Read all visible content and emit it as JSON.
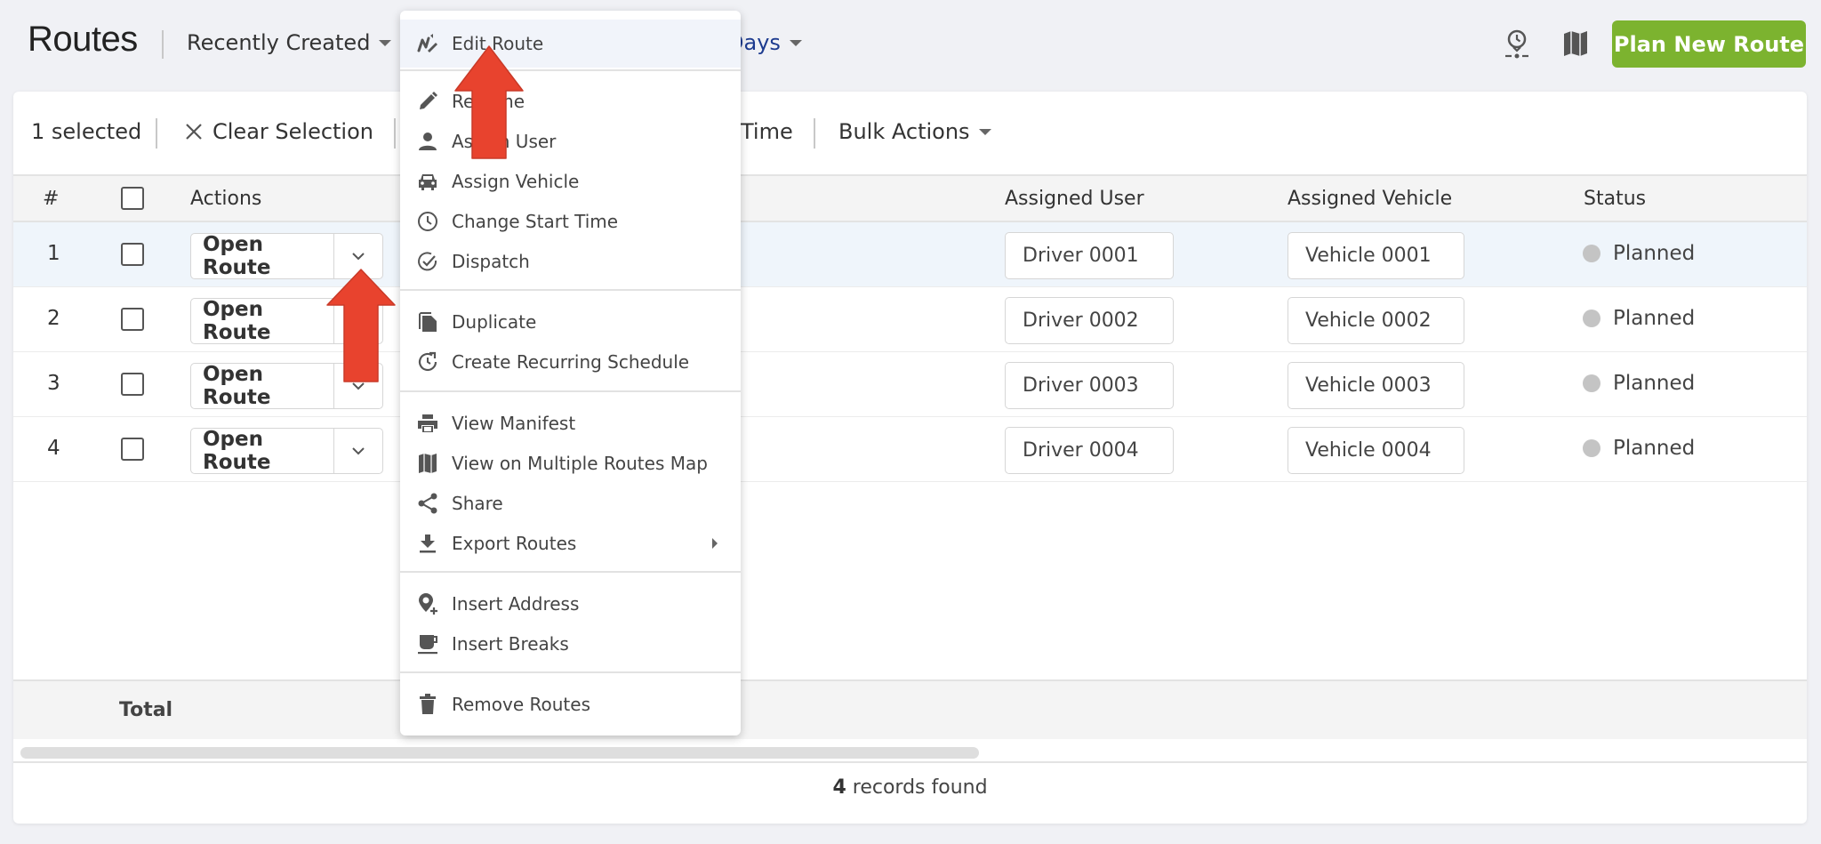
{
  "header": {
    "title": "Routes",
    "sort_dropdown": "Recently Created",
    "range_dropdown_partial": "Days",
    "plan_button": "Plan New Route",
    "icons": [
      "route-time-icon",
      "map-icon"
    ]
  },
  "toolbar": {
    "selected_count": "1 selected",
    "clear_selection": "Clear Selection",
    "hidden_partial": "Time",
    "bulk_actions": "Bulk Actions"
  },
  "table": {
    "columns": {
      "num": "#",
      "actions": "Actions",
      "assigned_user": "Assigned User",
      "assigned_vehicle": "Assigned Vehicle",
      "status": "Status"
    },
    "rows": [
      {
        "num": "1",
        "action": "Open Route",
        "user": "Driver 0001",
        "vehicle": "Vehicle 0001",
        "status": "Planned",
        "selected": true
      },
      {
        "num": "2",
        "action": "Open Route",
        "user": "Driver 0002",
        "vehicle": "Vehicle 0002",
        "status": "Planned",
        "selected": false
      },
      {
        "num": "3",
        "action": "Open Route",
        "user": "Driver 0003",
        "vehicle": "Vehicle 0003",
        "status": "Planned",
        "selected": false
      },
      {
        "num": "4",
        "action": "Open Route",
        "user": "Driver 0004",
        "vehicle": "Vehicle 0004",
        "status": "Planned",
        "selected": false
      }
    ],
    "footer_total": "Total",
    "records_count": "4",
    "records_suffix": " records found"
  },
  "menu": {
    "items": [
      {
        "label": "Edit Route",
        "icon": "edit-route-icon"
      },
      {
        "label": "Rename",
        "icon": "pencil-icon"
      },
      {
        "label": "Assign User",
        "icon": "user-icon"
      },
      {
        "label": "Assign Vehicle",
        "icon": "car-icon"
      },
      {
        "label": "Change Start Time",
        "icon": "clock-icon"
      },
      {
        "label": "Dispatch",
        "icon": "check-circle-icon"
      },
      {
        "label": "Duplicate",
        "icon": "duplicate-icon"
      },
      {
        "label": "Create Recurring Schedule",
        "icon": "recurring-icon"
      },
      {
        "label": "View Manifest",
        "icon": "printer-icon"
      },
      {
        "label": "View on Multiple Routes Map",
        "icon": "map-icon"
      },
      {
        "label": "Share",
        "icon": "share-icon"
      },
      {
        "label": "Export Routes",
        "icon": "download-icon",
        "submenu": true
      },
      {
        "label": "Insert Address",
        "icon": "add-location-icon"
      },
      {
        "label": "Insert Breaks",
        "icon": "coffee-icon"
      },
      {
        "label": "Remove Routes",
        "icon": "trash-icon"
      }
    ]
  },
  "colors": {
    "primary_green": "#7cb32f",
    "link_blue": "#1d3b8f",
    "annotation_red": "#e8432e",
    "status_planned": "#c4c4c4",
    "selected_row": "#eff5fb"
  }
}
